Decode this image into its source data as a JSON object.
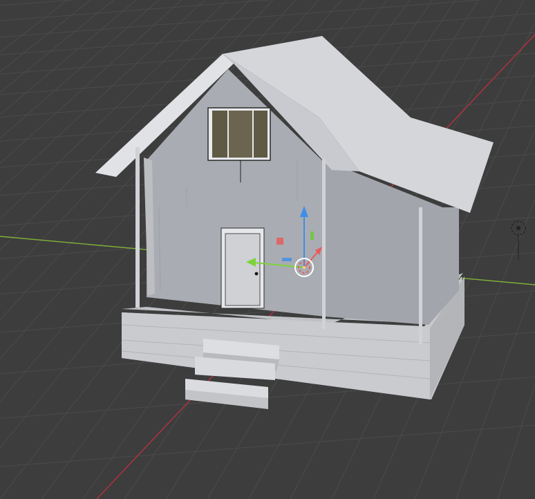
{
  "viewport": {
    "background": "#3d3d3d",
    "grid_color": "#4a4a4a",
    "x_axis_color": "#b5323f",
    "y_axis_color": "#7fb23b"
  },
  "scene": {
    "object": "house",
    "wall_color": "#a9acb2",
    "roof_color": "#d4d6da",
    "platform_color": "#c7c9cd",
    "window_glass_color": "#5f5a44"
  },
  "gizmo": {
    "x_arrow_color": "#7cd43a",
    "z_arrow_color": "#3d8ee8",
    "x_handle_color": "#e85b5b",
    "y_handle_color": "#73c44a"
  },
  "icons": {
    "origin": "object-origin-icon",
    "light": "light-object-icon",
    "camera": "3d-cursor-icon"
  }
}
